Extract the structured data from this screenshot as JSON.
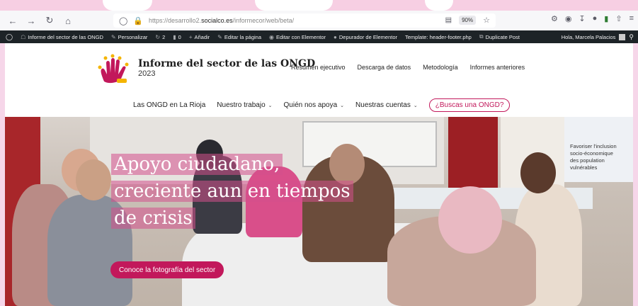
{
  "browser": {
    "url_prefix": "https://desarrollo2.",
    "url_domain": "socialco.es",
    "url_path": "/informecor/web/beta/",
    "zoom": "90%"
  },
  "admin_bar": {
    "items": [
      {
        "label": "Informe del sector de las ONGD",
        "icon": "home-icon"
      },
      {
        "label": "Personalizar",
        "icon": "brush-icon"
      },
      {
        "label": "2",
        "icon": "updates-icon"
      },
      {
        "label": "0",
        "icon": "comment-icon"
      },
      {
        "label": "Añadir",
        "icon": "plus-icon"
      },
      {
        "label": "Editar la página",
        "icon": "pencil-icon"
      },
      {
        "label": "Editar con Elementor",
        "icon": "elementor-icon"
      },
      {
        "label": "Depurador de Elementor",
        "icon": "info-icon"
      },
      {
        "label": "Template: header-footer.php",
        "icon": ""
      },
      {
        "label": "Duplicate Post",
        "icon": "copy-icon"
      }
    ],
    "greeting": "Hola, Marcela Palacios"
  },
  "header": {
    "title": "Informe del sector de las ONGD",
    "year": "2023",
    "top_menu": [
      "Resumen ejecutivo",
      "Descarga de datos",
      "Metodología",
      "Informes anteriores"
    ],
    "main_menu": [
      {
        "label": "Las ONGD en La Rioja",
        "dropdown": false
      },
      {
        "label": "Nuestro trabajo",
        "dropdown": true
      },
      {
        "label": "Quién nos apoya",
        "dropdown": true
      },
      {
        "label": "Nuestras cuentas",
        "dropdown": true
      }
    ],
    "cta": "¿Buscas una ONGD?"
  },
  "hero": {
    "title_lines": [
      "Apoyo ciudadano,",
      "creciente aun en tiempos",
      "de crisis"
    ],
    "button": "Conoce la fotografía del sector",
    "poster_lines": [
      "Favoriser l'inclusion",
      "socio-économique",
      "des population",
      "vulnérables"
    ]
  },
  "colors": {
    "accent": "#c2185b",
    "frame": "#f7cfe3",
    "admin_bar": "#1d2327"
  }
}
